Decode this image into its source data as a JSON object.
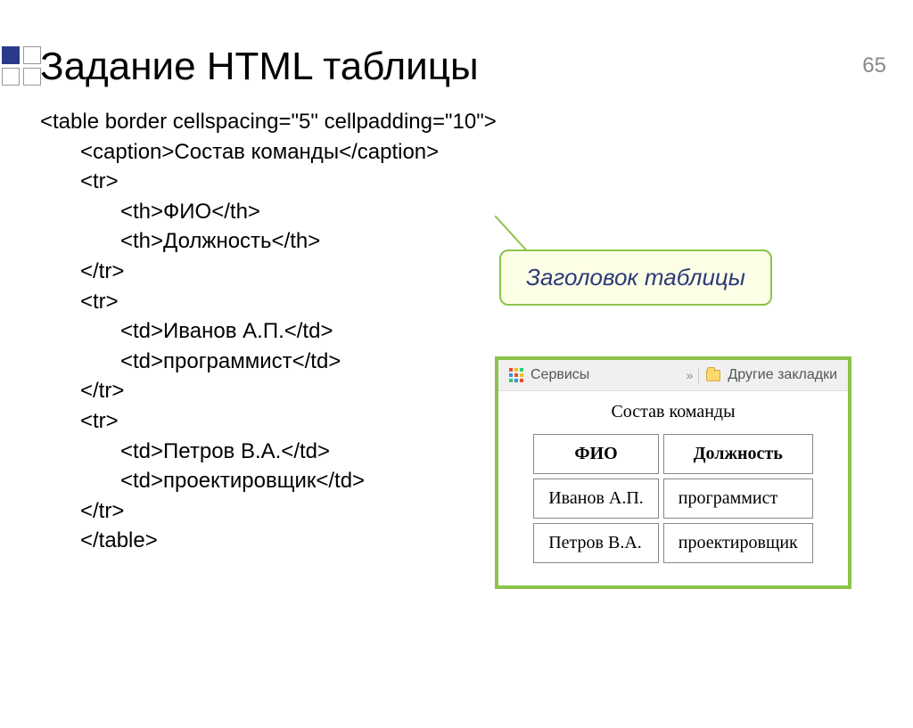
{
  "page_number": "65",
  "title": "Задание HTML таблицы",
  "code": {
    "line1": "<table border cellspacing=\"5\" cellpadding=\"10\">",
    "line2": "<caption>Состав команды</caption>",
    "line3": "<tr>",
    "line4": "<th>ФИО</th>",
    "line5": "<th>Должность</th>",
    "line6": "</tr>",
    "line7": "<tr>",
    "line8": "<td>Иванов А.П.</td>",
    "line9": "<td>программист</td>",
    "line10": "</tr>",
    "line11": "<tr>",
    "line12": "<td>Петров В.А.</td>",
    "line13": "<td>проектировщик</td>",
    "line14": "</tr>",
    "line15": "</table>"
  },
  "callout_text": "Заголовок таблицы",
  "browser": {
    "services": "Сервисы",
    "other_bookmarks": "Другие закладки"
  },
  "rendered": {
    "caption": "Состав команды",
    "headers": {
      "c1": "ФИО",
      "c2": "Должность"
    },
    "row1": {
      "c1": "Иванов А.П.",
      "c2": "программист"
    },
    "row2": {
      "c1": "Петров В.А.",
      "c2": "проектировщик"
    }
  }
}
